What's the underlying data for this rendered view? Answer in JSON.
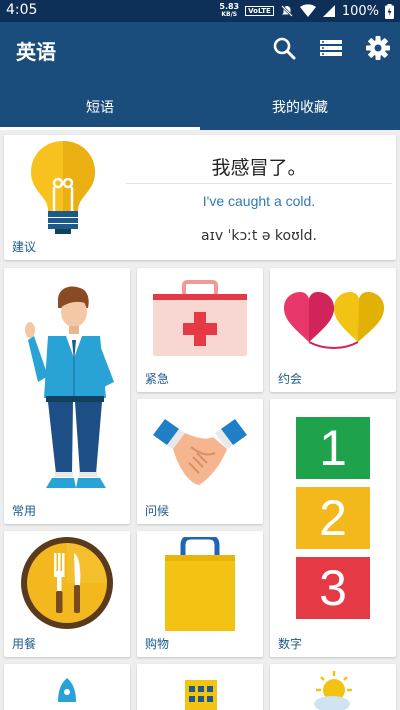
{
  "status_bar": {
    "time": "4:05",
    "speed_value": "5.83",
    "speed_unit": "KB/S",
    "volte": "VoLTE",
    "battery": "100%"
  },
  "app_bar": {
    "title": "英语",
    "tabs": [
      {
        "label": "短语",
        "active": true
      },
      {
        "label": "我的收藏",
        "active": false
      }
    ]
  },
  "tip_card": {
    "label": "建议",
    "phrase_cn": "我感冒了。",
    "phrase_en": "I've caught a cold.",
    "phonetic": "aɪv ˈkɔːt ə koʊld."
  },
  "categories": [
    {
      "label": "常用",
      "icon": "waving-man-icon"
    },
    {
      "label": "紧急",
      "icon": "first-aid-kit-icon"
    },
    {
      "label": "约会",
      "icon": "hearts-icon"
    },
    {
      "label": "问候",
      "icon": "handshake-icon"
    },
    {
      "label": "数字",
      "icon": "numbers-icon"
    },
    {
      "label": "用餐",
      "icon": "fork-knife-plate-icon"
    },
    {
      "label": "购物",
      "icon": "shopping-bag-icon"
    }
  ],
  "number_blocks": [
    "1",
    "2",
    "3"
  ],
  "colors": {
    "status_bar": "#0e2f58",
    "app_bar": "#1b4d7c",
    "label_blue": "#1d5a8a",
    "english_blue": "#2e7bb5",
    "background": "#eeeeee"
  }
}
